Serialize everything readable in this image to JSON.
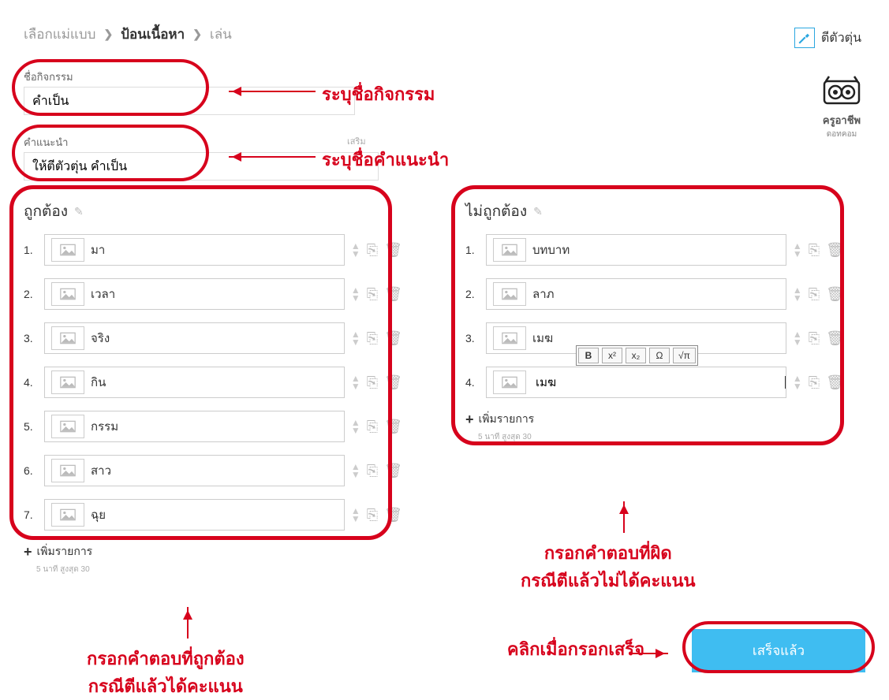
{
  "breadcrumb": {
    "step1": "เลือกแม่แบบ",
    "step2": "ป้อนเนื้อหา",
    "step3": "เล่น"
  },
  "top_right": {
    "label": "ตีตัวตุ่น"
  },
  "logo": {
    "line1": "ครูอาชีพ",
    "line2": "ดอทคอม"
  },
  "fields": {
    "activity_label": "ชื่อกิจกรรม",
    "activity_value": "คำเป็น",
    "hint_label": "คำแนะนำ",
    "hint_extra": "เสริม",
    "hint_value": "ให้ตีตัวตุ่น คำเป็น"
  },
  "annotations": {
    "activity": "ระบุชื่อกิจกรรม",
    "hint": "ระบุชื่อคำแนะนำ",
    "correct_line1": "กรอกคำตอบที่ถูกต้อง",
    "correct_line2": "กรณีตีแล้วได้คะแนน",
    "incorrect_line1": "กรอกคำตอบที่ผิด",
    "incorrect_line2": "กรณีตีแล้วไม่ได้คะแนน",
    "done": "คลิกเมื่อกรอกเสร็จ"
  },
  "correct": {
    "title": "ถูกต้อง",
    "items": [
      "มา",
      "เวลา",
      "จริง",
      "กิน",
      "กรรม",
      "สาว",
      "ฉุย"
    ],
    "add": "เพิ่มรายการ",
    "limit": "5 นาที  สูงสุด 30"
  },
  "incorrect": {
    "title": "ไม่ถูกต้อง",
    "items": [
      "บทบาท",
      "ลาภ",
      "เมฆ",
      "เมฆ"
    ],
    "add": "เพิ่มรายการ",
    "limit": "5 นาที  สูงสุด 30"
  },
  "toolbar": {
    "bold": "B",
    "sup": "x²",
    "sub": "x₂",
    "omega": "Ω",
    "sqrt": "√π"
  },
  "done_button": "เสร็จแล้ว"
}
